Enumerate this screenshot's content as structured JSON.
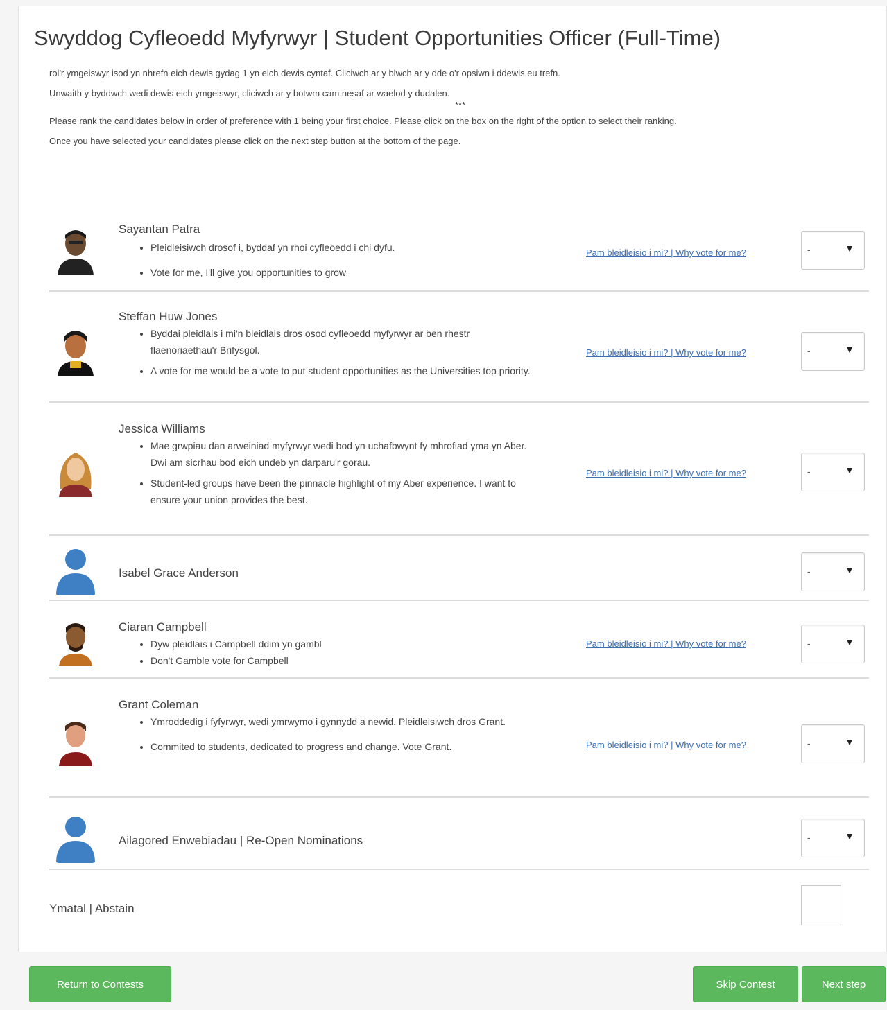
{
  "contest": {
    "title": "Swyddog Cyfleoedd Myfyrwyr | Student Opportunities Officer (Full-Time)",
    "instructions": {
      "welsh_1": "rol'r ymgeiswyr isod yn nhrefn eich dewis gydag 1 yn eich dewis cyntaf. Cliciwch ar y blwch ar y dde o'r opsiwn i ddewis eu trefn.",
      "welsh_2": "Unwaith y byddwch wedi dewis eich ymgeiswyr, cliciwch ar y botwm cam nesaf ar waelod y dudalen.",
      "separator": "***",
      "english_1": "Please rank the candidates below in order of preference with 1 being your first choice. Please click on the box on the right of the option to select their ranking.",
      "english_2": "Once you have selected your candidates please click on the next step button at the bottom of the page."
    }
  },
  "link_text": "Pam bleidleisio i mi? | Why vote for me?",
  "candidates": [
    {
      "name": "Sayantan Patra",
      "bullets": [
        "Pleidleisiwch drosof i, byddaf yn rhoi cyfleoedd i chi dyfu.",
        "Vote for me, I'll give you opportunities to grow"
      ],
      "rank": "-"
    },
    {
      "name": "Steffan Huw Jones",
      "bullets": [
        "Byddai pleidlais i mi'n bleidlais dros osod cyfleoedd myfyrwyr ar ben rhestr flaenoriaethau'r Brifysgol.",
        "A vote for me would be a vote to put student opportunities as the Universities top priority."
      ],
      "rank": "-"
    },
    {
      "name": "Jessica Williams",
      "bullets": [
        "Mae grwpiau dan arweiniad myfyrwyr wedi bod yn uchafbwynt fy mhrofiad yma yn Aber.  Dwi am sicrhau bod eich undeb yn darparu'r gorau.",
        "Student-led groups have been the pinnacle highlight of my Aber experience.  I want to ensure your union provides the best."
      ],
      "rank": "-"
    },
    {
      "name": "Isabel Grace Anderson",
      "bullets": [],
      "rank": "-"
    },
    {
      "name": "Ciaran Campbell",
      "bullets": [
        "Dyw pleidlais i Campbell ddim yn gambl",
        "Don't Gamble vote for Campbell"
      ],
      "rank": "-"
    },
    {
      "name": "Grant Coleman",
      "bullets": [
        "Ymroddedig i fyfyrwyr, wedi ymrwymo i gynnydd a newid. Pleidleisiwch dros Grant.",
        "Commited to students, dedicated to progress and change. Vote Grant."
      ],
      "rank": "-"
    },
    {
      "name": "Ailagored Enwebiadau | Re-Open Nominations",
      "bullets": [],
      "rank": "-"
    }
  ],
  "abstain": {
    "label": "Ymatal | Abstain"
  },
  "buttons": {
    "return": "Return to Contests",
    "skip": "Skip Contest",
    "next": "Next step"
  },
  "colors": {
    "button_green": "#5cb85c",
    "link_blue": "#3e6fb0",
    "placeholder_avatar_blue": "#3f7fc4"
  }
}
